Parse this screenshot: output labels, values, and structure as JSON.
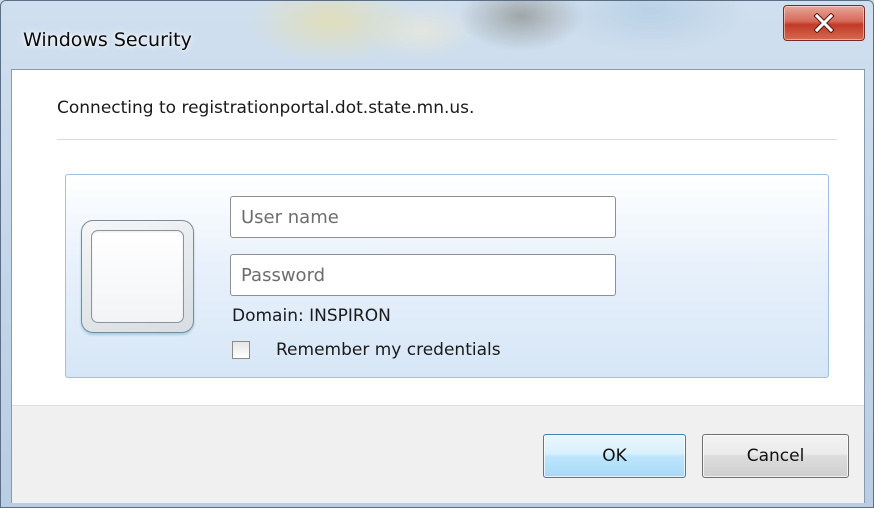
{
  "window": {
    "title": "Windows Security",
    "close_icon": "close-x"
  },
  "dialog": {
    "connecting_text": "Connecting to registrationportal.dot.state.mn.us.",
    "credential_tile_icon": "user-tile-placeholder",
    "username": {
      "value": "",
      "placeholder": "User name"
    },
    "password": {
      "value": "",
      "placeholder": "Password"
    },
    "domain_text": "Domain: INSPIRON",
    "remember": {
      "label": "Remember my credentials",
      "checked": false
    }
  },
  "buttons": {
    "ok_label": "OK",
    "cancel_label": "Cancel"
  },
  "colors": {
    "close_button": "#c13a27",
    "ok_border": "#3c7fb1",
    "panel_border": "#9fc0e0"
  }
}
